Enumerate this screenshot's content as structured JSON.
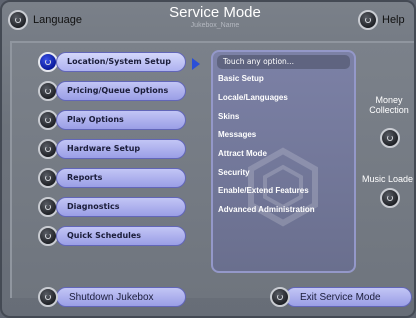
{
  "header": {
    "language_label": "Language",
    "title": "Service Mode",
    "subtitle": "Jukebox_Name",
    "help_label": "Help"
  },
  "menu": [
    {
      "label": "Location/System Setup",
      "active": true
    },
    {
      "label": "Pricing/Queue Options",
      "active": false
    },
    {
      "label": "Play Options",
      "active": false
    },
    {
      "label": "Hardware Setup",
      "active": false
    },
    {
      "label": "Reports",
      "active": false
    },
    {
      "label": "Diagnostics",
      "active": false
    },
    {
      "label": "Quick Schedules",
      "active": false
    }
  ],
  "options_panel": {
    "prompt": "Touch any option...",
    "options": [
      "Basic Setup",
      "Locale/Languages",
      "Skins",
      "Messages",
      "Attract Mode",
      "Security",
      "Enable/Extend Features",
      "Advanced Administration"
    ]
  },
  "side": {
    "money_collection": "Money Collection",
    "music_load": "Music Loade"
  },
  "footer": {
    "shutdown_label": "Shutdown Jukebox",
    "exit_label": "Exit Service Mode"
  },
  "colors": {
    "accent_blue": "#2a4fd8",
    "button_fill": "#b4b8f0",
    "background": "#6d737c"
  }
}
